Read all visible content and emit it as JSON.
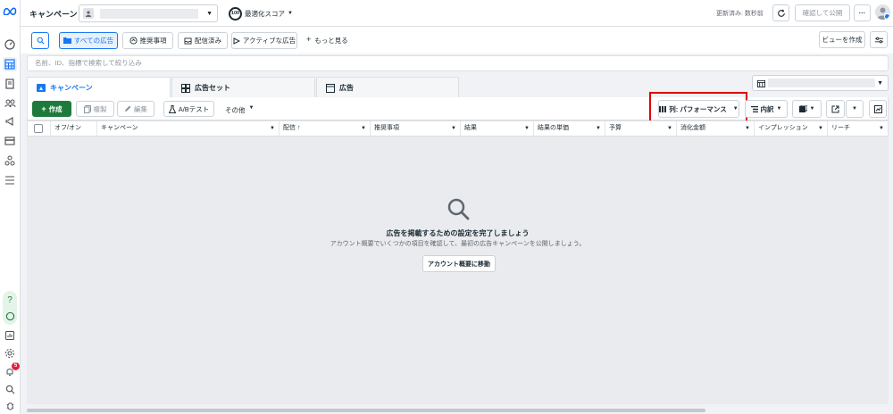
{
  "header": {
    "title": "キャンペーン",
    "optimization_label": "最適化スコア",
    "optimization_score": "100",
    "updated_text": "更新済み: 数秒前",
    "review_publish_label": "確認して公開",
    "more_label": "···"
  },
  "filters": {
    "all_ads": "すべての広告",
    "recommendations": "推奨事項",
    "delivered": "配信済み",
    "active_ads": "アクティブな広告",
    "see_more": "もっと見る",
    "create_view": "ビューを作成"
  },
  "search": {
    "placeholder": "名前、ID、指標で検索して絞り込み"
  },
  "tabs": [
    {
      "label": "キャンペーン"
    },
    {
      "label": "広告セット"
    },
    {
      "label": "広告"
    }
  ],
  "toolbar": {
    "create": "作成",
    "duplicate": "複製",
    "edit": "編集",
    "ab_test": "A/Bテスト",
    "more": "その他",
    "columns": "列: パフォーマンス",
    "breakdown": "内訳"
  },
  "table": {
    "columns": [
      "オフ/オン",
      "キャンペーン",
      "配信 ↑",
      "推奨事項",
      "結果",
      "結果の単価",
      "予算",
      "消化金額",
      "インプレッション",
      "リーチ"
    ]
  },
  "empty_state": {
    "title": "広告を掲載するための設定を完了しましょう",
    "description": "アカウント概要でいくつかの項目を確認して、最初の広告キャンペーンを公開しましょう。",
    "button": "アカウント概要に移動"
  },
  "notifications": {
    "count": "5"
  },
  "colors": {
    "accent": "#1877f2",
    "create": "#1e7a3c",
    "highlight": "#e00000"
  }
}
